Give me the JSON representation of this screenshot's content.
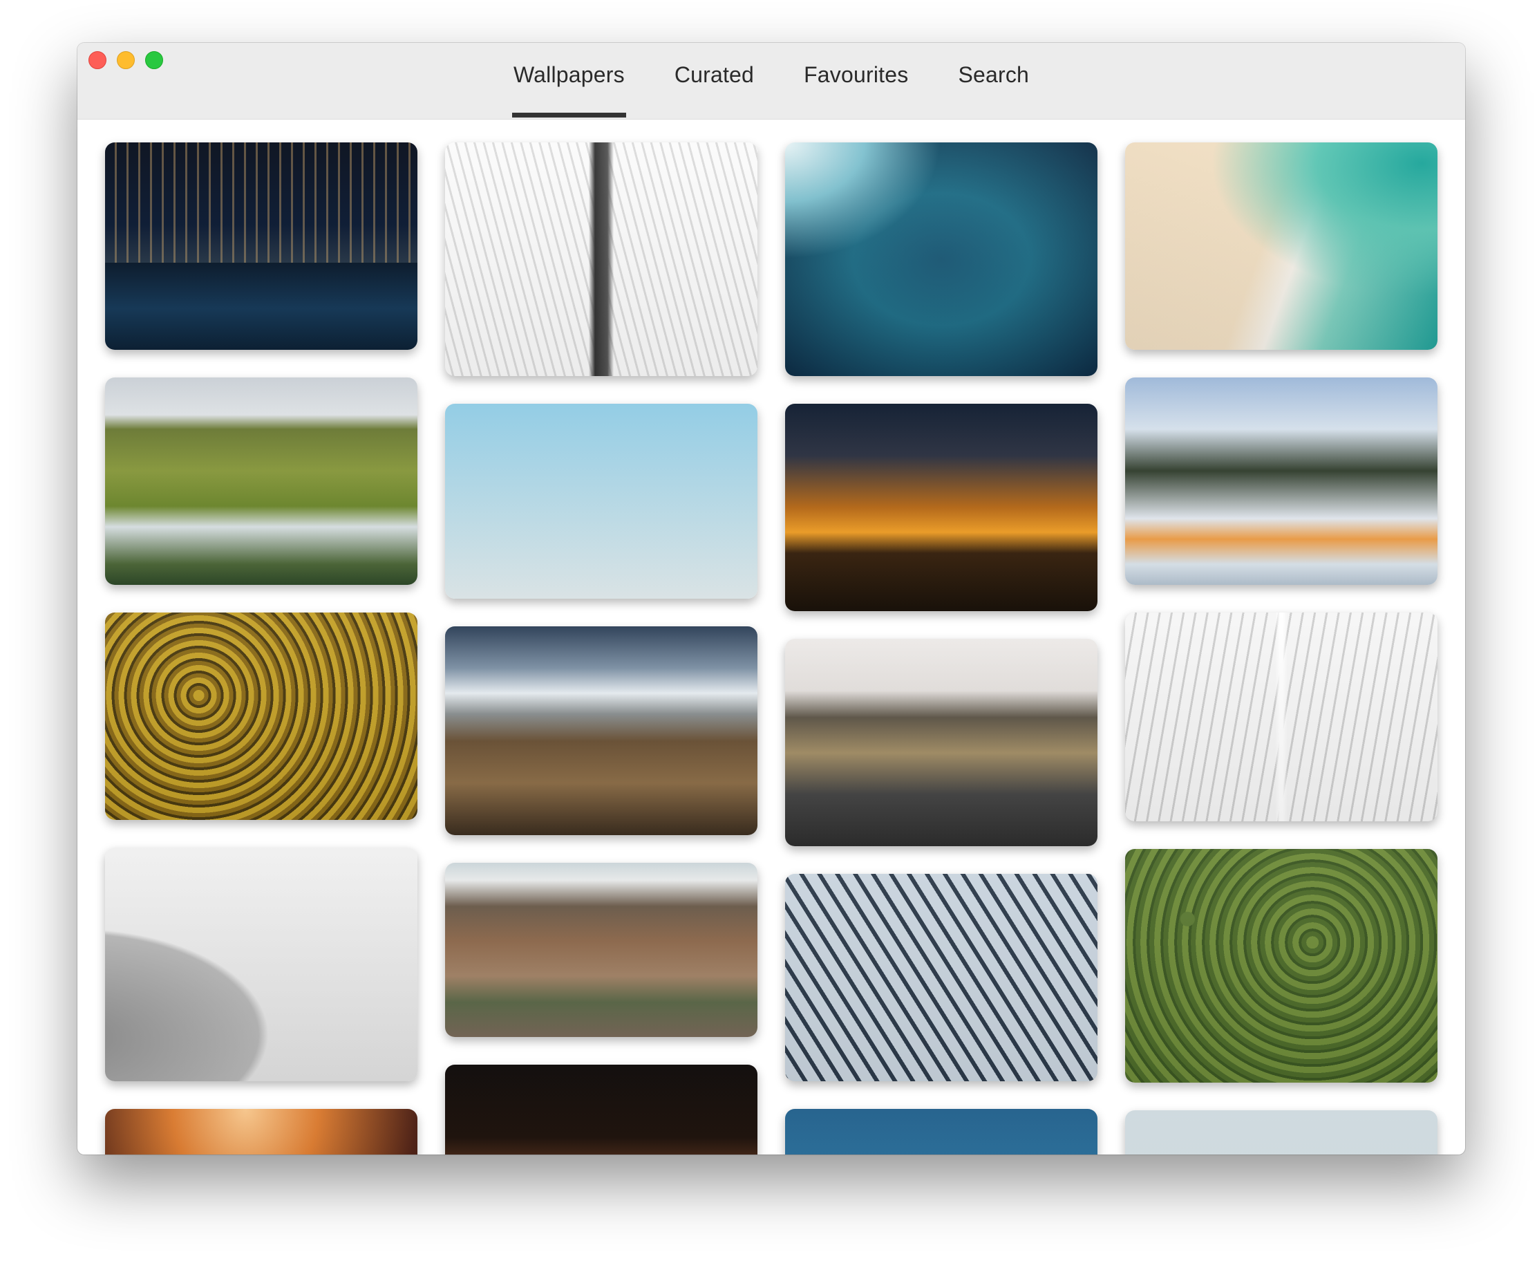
{
  "tabs": [
    {
      "label": "Wallpapers",
      "active": true
    },
    {
      "label": "Curated",
      "active": false
    },
    {
      "label": "Favourites",
      "active": false
    },
    {
      "label": "Search",
      "active": false
    }
  ],
  "colors": {
    "titlebar": "#ececec",
    "tab_indicator": "#333333",
    "traffic_close": "#fd5e57",
    "traffic_minimize": "#febc2e",
    "traffic_zoom": "#29c840"
  },
  "columns": [
    [
      "city-skyline-night",
      "white-ribbed-hall",
      "aerial-forest-yellow",
      "perforated-dome-facade",
      "orange-glow"
    ],
    [
      "white-ribbed-hall-up",
      "palm-trees-sky",
      "penguin-colony-mountains",
      "colorful-mountains",
      "cave-opening"
    ],
    [
      "ocean-waves-aerial",
      "penguins-sunset",
      "empty-road-mountains",
      "building-facade-grid",
      "island-aerial-sea"
    ],
    [
      "beach-shoreline-aerial",
      "snowy-mountain-road",
      "oculus-interior",
      "green-forest-boardwalk",
      "calm-sea"
    ]
  ]
}
